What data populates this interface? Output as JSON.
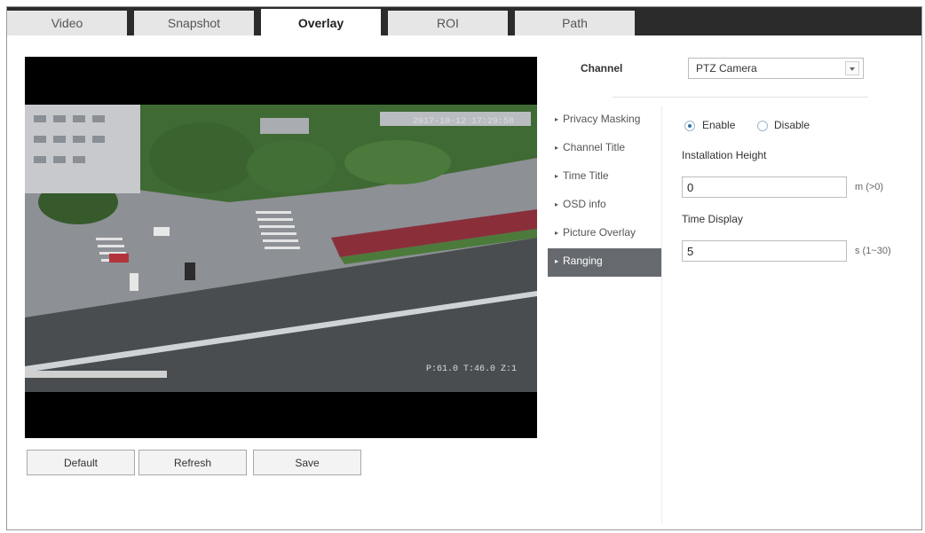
{
  "tabs": [
    {
      "label": "Video"
    },
    {
      "label": "Snapshot"
    },
    {
      "label": "Overlay"
    },
    {
      "label": "ROI"
    },
    {
      "label": "Path"
    }
  ],
  "active_tab": "Overlay",
  "video": {
    "osd_time": "2017-10-12 17:29:58",
    "osd_ptz": "P:61.0 T:46.0 Z:1"
  },
  "buttons": {
    "default": "Default",
    "refresh": "Refresh",
    "save": "Save"
  },
  "channel": {
    "label": "Channel",
    "value": "PTZ Camera"
  },
  "menu": [
    {
      "label": "Privacy Masking"
    },
    {
      "label": "Channel Title"
    },
    {
      "label": "Time Title"
    },
    {
      "label": "OSD info"
    },
    {
      "label": "Picture Overlay"
    },
    {
      "label": "Ranging"
    }
  ],
  "active_menu": "Ranging",
  "ranging": {
    "enable_label": "Enable",
    "disable_label": "Disable",
    "selected": "Enable",
    "installation_height_label": "Installation Height",
    "installation_height_value": "0",
    "installation_height_unit": "m (>0)",
    "time_display_label": "Time Display",
    "time_display_value": "5",
    "time_display_unit": "s (1~30)"
  },
  "colors": {
    "tab_bar": "#2b2b2b",
    "active_menu": "#666a6e",
    "radio_accent": "#2f6ea8"
  }
}
